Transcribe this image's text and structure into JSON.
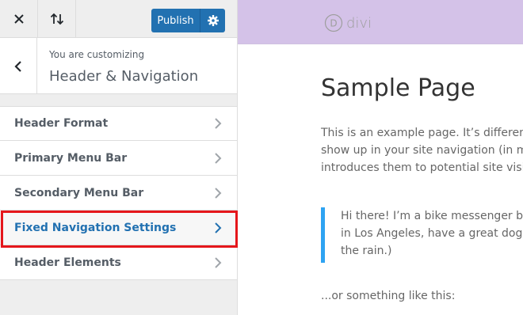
{
  "topbar": {
    "close_icon": "close-icon",
    "reorder_icon": "arrows-up-down-icon",
    "publish_label": "Publish",
    "settings_icon": "gear-icon"
  },
  "section": {
    "customizing_label": "You are customizing",
    "title": "Header & Navigation",
    "back_icon": "chevron-left-icon"
  },
  "menu": {
    "items": [
      {
        "label": "Header Format"
      },
      {
        "label": "Primary Menu Bar"
      },
      {
        "label": "Secondary Menu Bar"
      },
      {
        "label": "Fixed Navigation Settings",
        "highlighted": true
      },
      {
        "label": "Header Elements"
      }
    ]
  },
  "preview": {
    "logo_letter": "D",
    "logo_text": "divi",
    "page_title": "Sample Page",
    "paragraph_lines": [
      "This is an example page. It’s different fr",
      "show up in your site navigation (in most",
      "introduces them to potential site visitor"
    ],
    "quote_lines": [
      "Hi there! I’m a bike messenger by da",
      "in Los Angeles, have a great dog nar",
      "the rain.)"
    ],
    "outro": "...or something like this:"
  },
  "colors": {
    "accent": "#2271b1",
    "highlight_border": "#e5161b",
    "header_bg": "#d4c2e8",
    "quote_border": "#2ea3f2"
  }
}
